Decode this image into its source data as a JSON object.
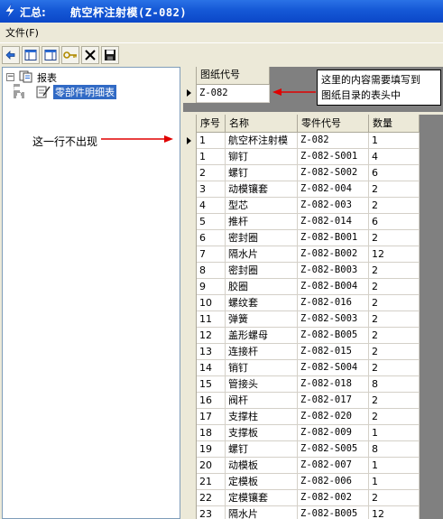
{
  "window": {
    "title_prefix": "汇总:",
    "title": "航空杯注射模(Z-082)"
  },
  "menu": {
    "items": [
      {
        "label": "文件(F)"
      }
    ]
  },
  "toolbar": {
    "buttons": [
      {
        "icon": "back-arrow-icon"
      },
      {
        "icon": "window-layout-icon"
      },
      {
        "icon": "window-layout-alt-icon"
      },
      {
        "icon": "key-icon"
      },
      {
        "icon": "delete-x-icon"
      },
      {
        "icon": "save-disk-icon"
      }
    ]
  },
  "tree": {
    "root": {
      "label": "报表",
      "expander": "−"
    },
    "children": [
      {
        "label": "零部件明细表",
        "selected": true
      }
    ]
  },
  "annotations": {
    "left_note": "这一行不出现",
    "callout_line1": "这里的内容需要填写到",
    "callout_line2": "图纸目录的表头中"
  },
  "header_grid": {
    "column": "图纸代号",
    "value": "Z-082"
  },
  "parts_table": {
    "columns": [
      "序号",
      "名称",
      "零件代号",
      "数量"
    ],
    "rows": [
      [
        "1",
        "航空杯注射模",
        "Z-082",
        "1"
      ],
      [
        "1",
        "铆钉",
        "Z-082-S001",
        "4"
      ],
      [
        "2",
        "螺钉",
        "Z-082-S002",
        "6"
      ],
      [
        "3",
        "动模镶套",
        "Z-082-004",
        "2"
      ],
      [
        "4",
        "型芯",
        "Z-082-003",
        "2"
      ],
      [
        "5",
        "推杆",
        "Z-082-014",
        "6"
      ],
      [
        "6",
        "密封圈",
        "Z-082-B001",
        "2"
      ],
      [
        "7",
        "隔水片",
        "Z-082-B002",
        "12"
      ],
      [
        "8",
        "密封圈",
        "Z-082-B003",
        "2"
      ],
      [
        "9",
        "胶圈",
        "Z-082-B004",
        "2"
      ],
      [
        "10",
        "螺纹套",
        "Z-082-016",
        "2"
      ],
      [
        "11",
        "弹簧",
        "Z-082-S003",
        "2"
      ],
      [
        "12",
        "盖形螺母",
        "Z-082-B005",
        "2"
      ],
      [
        "13",
        "连接杆",
        "Z-082-015",
        "2"
      ],
      [
        "14",
        "销钉",
        "Z-082-S004",
        "2"
      ],
      [
        "15",
        "管接头",
        "Z-082-018",
        "8"
      ],
      [
        "16",
        "阀杆",
        "Z-082-017",
        "2"
      ],
      [
        "17",
        "支撑柱",
        "Z-082-020",
        "2"
      ],
      [
        "18",
        "支撑板",
        "Z-082-009",
        "1"
      ],
      [
        "19",
        "螺钉",
        "Z-082-S005",
        "8"
      ],
      [
        "20",
        "动模板",
        "Z-082-007",
        "1"
      ],
      [
        "21",
        "定模板",
        "Z-082-006",
        "1"
      ],
      [
        "22",
        "定模镶套",
        "Z-082-002",
        "2"
      ],
      [
        "23",
        "隔水片",
        "Z-082-B005",
        "12"
      ]
    ]
  },
  "colors": {
    "titlebar": "#0b47c8",
    "selection": "#316ac5",
    "arrow": "#e00000",
    "panel_bg": "#ece9d8",
    "grid_gray": "#808080"
  }
}
